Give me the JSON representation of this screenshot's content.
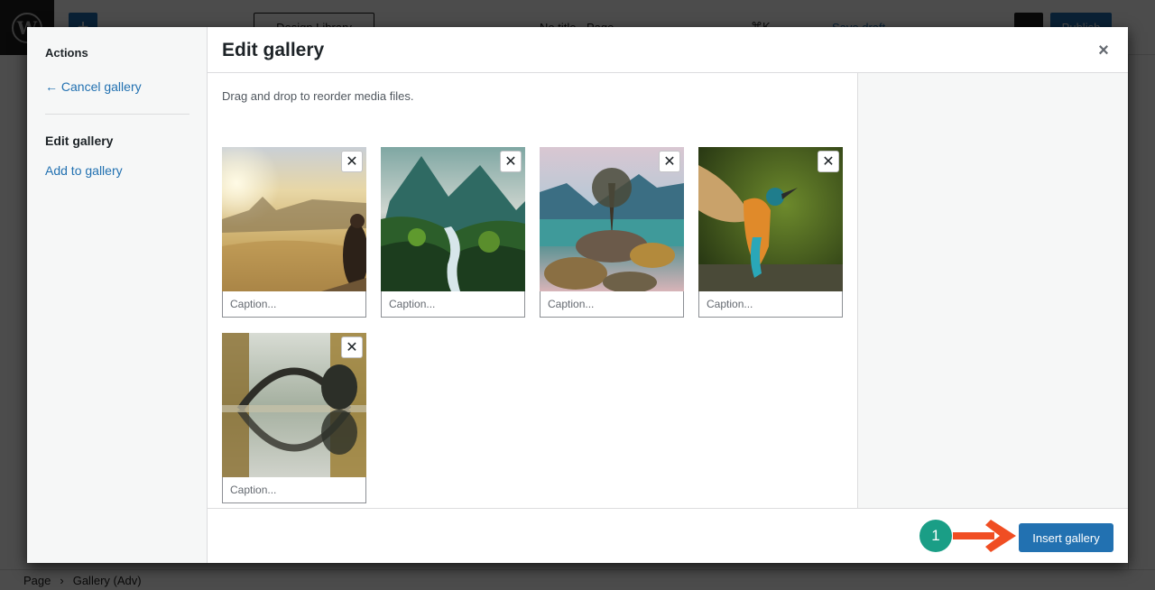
{
  "editor": {
    "logo": "W",
    "add_icon": "+",
    "design_library": "Design Library",
    "doc_title": "No title · Page",
    "shortcut": "⌘K",
    "save_draft": "Save draft",
    "publish": "Publish",
    "breadcrumb": [
      "Page",
      "Gallery (Adv)"
    ],
    "breadcrumb_separator": "›"
  },
  "modal": {
    "menu": {
      "heading": "Actions",
      "cancel_label": "← Cancel gallery",
      "active_label": "Edit gallery",
      "add_label": "Add to gallery"
    },
    "title": "Edit gallery",
    "close_icon": "×",
    "instructions": "Drag and drop to reorder media files.",
    "attachments": [
      {
        "description": "Photographer on mountain at sunrise above clouds",
        "caption_placeholder": "Caption...",
        "caption_value": "",
        "remove_icon": "✕"
      },
      {
        "description": "Misty mountains with waterfall and forest",
        "caption_placeholder": "Caption...",
        "caption_value": "",
        "remove_icon": "✕"
      },
      {
        "description": "Lone tree on rocky island in mountain lake",
        "caption_placeholder": "Caption...",
        "caption_value": "",
        "remove_icon": "✕"
      },
      {
        "description": "Kingfisher bird emerging from water",
        "caption_placeholder": "Caption...",
        "caption_value": "",
        "remove_icon": "✕"
      },
      {
        "description": "Stone arch bridge reflected in autumn lake",
        "caption_placeholder": "Caption...",
        "caption_value": "",
        "remove_icon": "✕"
      }
    ],
    "insert_button": "Insert gallery"
  },
  "annotation": {
    "step_number": "1",
    "badge_color": "#1a9e86",
    "arrow_color": "#f04e23"
  },
  "colors": {
    "accent": "#2271b1",
    "menu_bg": "#f6f7f7"
  }
}
